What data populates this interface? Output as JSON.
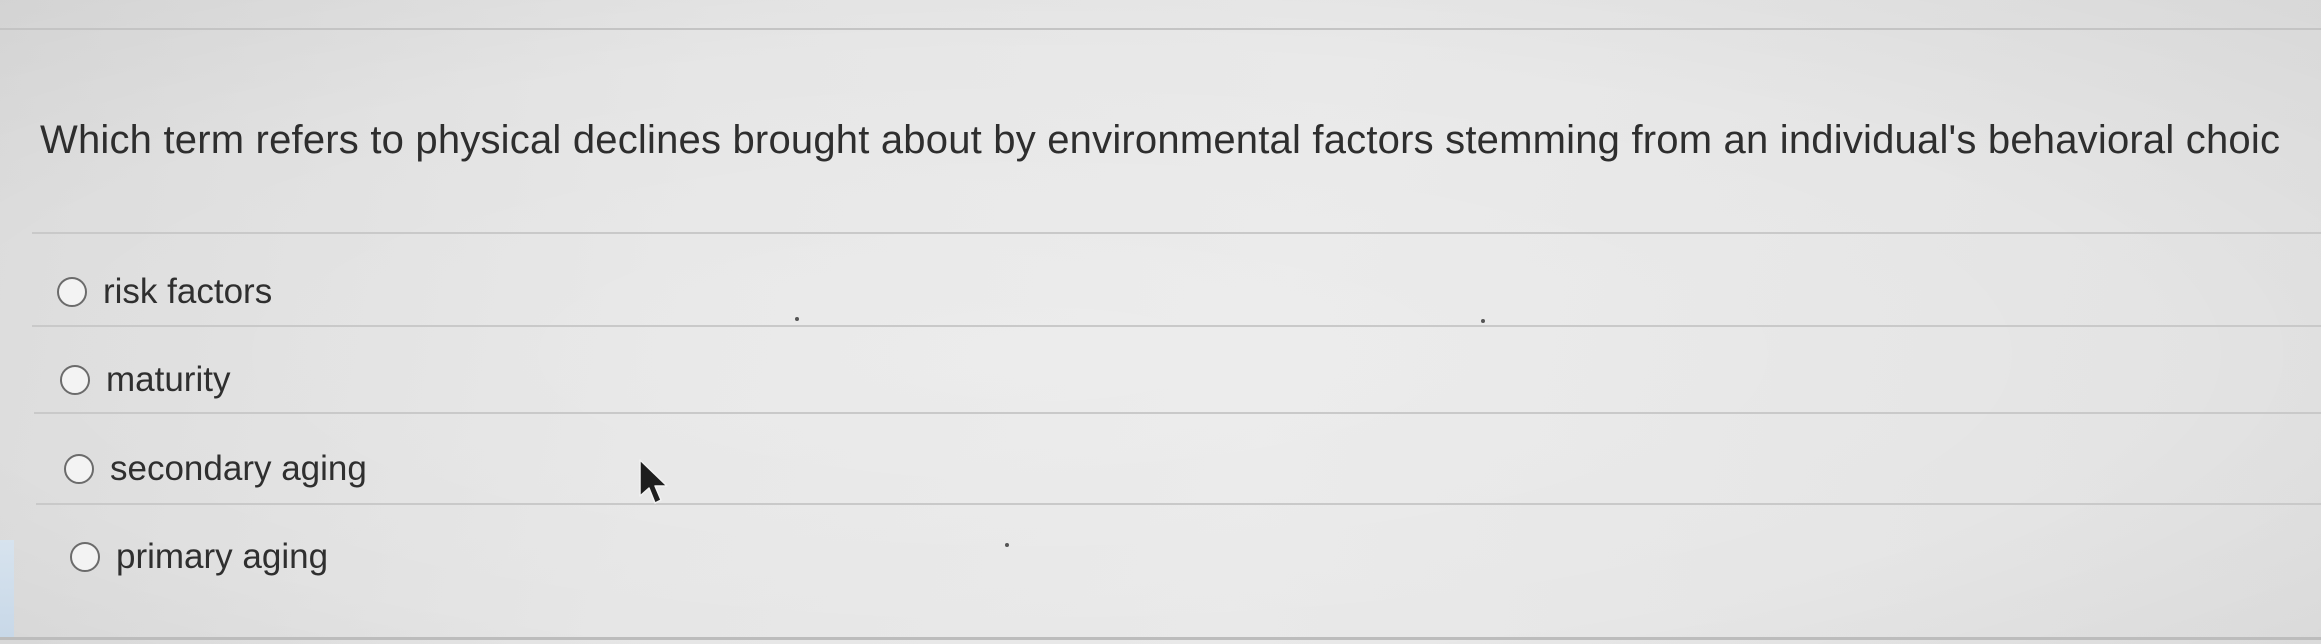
{
  "question": {
    "text": "Which term refers to physical declines brought about by environmental factors stemming from an individual's behavioral choic"
  },
  "options": [
    {
      "label": "risk factors",
      "selected": false
    },
    {
      "label": "maturity",
      "selected": false
    },
    {
      "label": "secondary aging",
      "selected": false
    },
    {
      "label": "primary aging",
      "selected": false
    }
  ],
  "icons": {
    "radio": "radio-button-icon",
    "cursor": "mouse-pointer-icon"
  },
  "colors": {
    "background": "#e6e6e6",
    "text": "#2e2e2e",
    "separator": "#c9c9c9"
  }
}
